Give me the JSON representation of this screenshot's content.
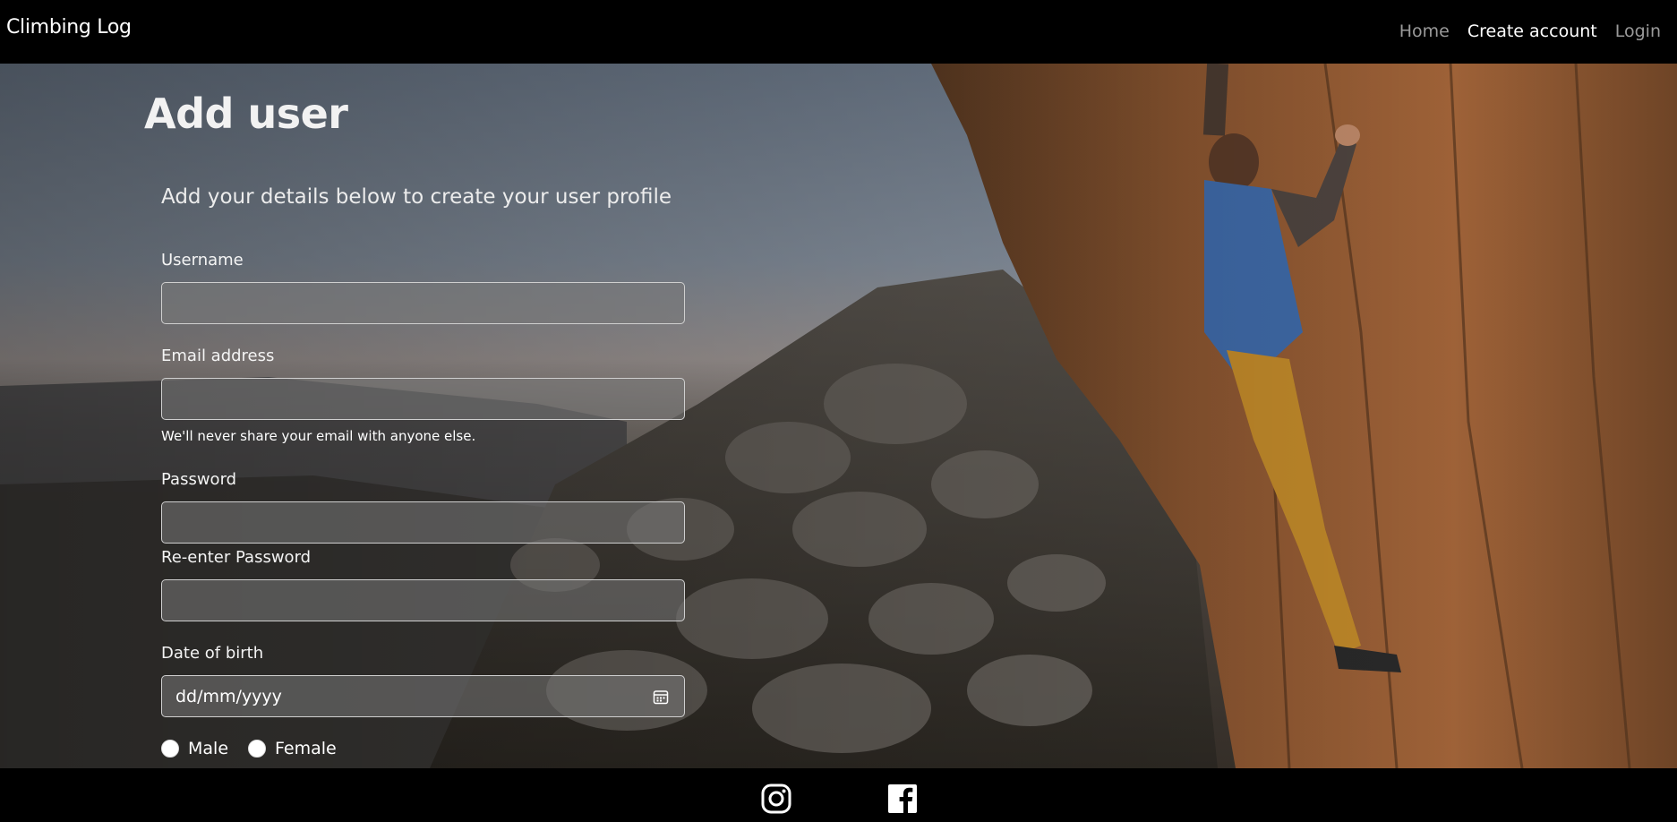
{
  "navbar": {
    "brand": "Climbing Log",
    "links": [
      {
        "label": "Home",
        "active": false
      },
      {
        "label": "Create account",
        "active": true
      },
      {
        "label": "Login",
        "active": false
      }
    ]
  },
  "form": {
    "title": "Add user",
    "subtitle": "Add your details below to create your user profile",
    "username_label": "Username",
    "username_value": "",
    "email_label": "Email address",
    "email_value": "",
    "email_help": "We'll never share your email with anyone else.",
    "password_label": "Password",
    "password_value": "",
    "reenter_label": "Re-enter Password",
    "reenter_value": "",
    "dob_label": "Date of birth",
    "dob_placeholder": "dd/mm/yyyy",
    "gender_options": [
      "Male",
      "Female"
    ]
  },
  "footer": {
    "icons": [
      "instagram-icon",
      "facebook-icon"
    ]
  }
}
